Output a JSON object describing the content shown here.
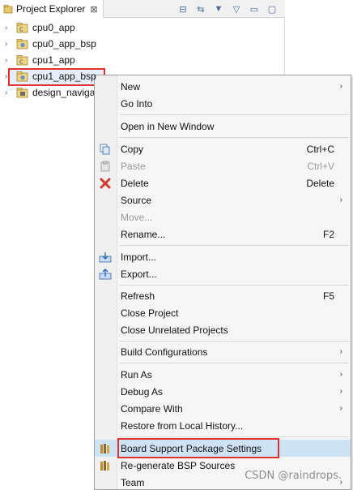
{
  "colors": {
    "selection_outline": "#e0322f",
    "menu_highlight": "#cfe3f7",
    "menu_bg": "#f6f6f6"
  },
  "view": {
    "title": "Project Explorer",
    "close_glyph": "⊠",
    "toolbar": [
      {
        "name": "collapse-all-icon",
        "glyph": "⊟"
      },
      {
        "name": "link-with-editor-icon",
        "glyph": "⇆"
      },
      {
        "name": "filter-icon",
        "glyph": "▼"
      },
      {
        "name": "view-menu-icon",
        "glyph": "▽"
      },
      {
        "name": "minimize-icon",
        "glyph": "▭"
      },
      {
        "name": "maximize-icon",
        "glyph": "▢"
      }
    ]
  },
  "tree": {
    "items": [
      {
        "label": "cpu0_app",
        "icon": "c-project-icon"
      },
      {
        "label": "cpu0_app_bsp",
        "icon": "bsp-project-icon"
      },
      {
        "label": "cpu1_app",
        "icon": "c-project-icon"
      },
      {
        "label": "cpu1_app_bsp",
        "icon": "bsp-project-icon",
        "selected": true
      },
      {
        "label": "design_naviga",
        "icon": "hw-platform-icon"
      }
    ]
  },
  "menu": {
    "items": [
      {
        "label": "New",
        "accel": "",
        "submenu": true,
        "disabled": false,
        "icon": ""
      },
      {
        "label": "Go Into",
        "accel": "",
        "submenu": false,
        "disabled": false,
        "icon": ""
      },
      {
        "sep": true
      },
      {
        "label": "Open in New Window",
        "accel": "",
        "submenu": false,
        "disabled": false,
        "icon": ""
      },
      {
        "sep": true
      },
      {
        "label": "Copy",
        "accel": "Ctrl+C",
        "submenu": false,
        "disabled": false,
        "icon": "copy-icon"
      },
      {
        "label": "Paste",
        "accel": "Ctrl+V",
        "submenu": false,
        "disabled": true,
        "icon": "paste-icon"
      },
      {
        "label": "Delete",
        "accel": "Delete",
        "submenu": false,
        "disabled": false,
        "icon": "delete-icon"
      },
      {
        "label": "Source",
        "accel": "",
        "submenu": true,
        "disabled": false,
        "icon": ""
      },
      {
        "label": "Move...",
        "accel": "",
        "submenu": false,
        "disabled": true,
        "icon": ""
      },
      {
        "label": "Rename...",
        "accel": "F2",
        "submenu": false,
        "disabled": false,
        "icon": ""
      },
      {
        "sep": true
      },
      {
        "label": "Import...",
        "accel": "",
        "submenu": false,
        "disabled": false,
        "icon": "import-icon"
      },
      {
        "label": "Export...",
        "accel": "",
        "submenu": false,
        "disabled": false,
        "icon": "export-icon"
      },
      {
        "sep": true
      },
      {
        "label": "Refresh",
        "accel": "F5",
        "submenu": false,
        "disabled": false,
        "icon": ""
      },
      {
        "label": "Close Project",
        "accel": "",
        "submenu": false,
        "disabled": false,
        "icon": ""
      },
      {
        "label": "Close Unrelated Projects",
        "accel": "",
        "submenu": false,
        "disabled": false,
        "icon": ""
      },
      {
        "sep": true
      },
      {
        "label": "Build Configurations",
        "accel": "",
        "submenu": true,
        "disabled": false,
        "icon": ""
      },
      {
        "sep": true
      },
      {
        "label": "Run As",
        "accel": "",
        "submenu": true,
        "disabled": false,
        "icon": ""
      },
      {
        "label": "Debug As",
        "accel": "",
        "submenu": true,
        "disabled": false,
        "icon": ""
      },
      {
        "label": "Compare With",
        "accel": "",
        "submenu": true,
        "disabled": false,
        "icon": ""
      },
      {
        "label": "Restore from Local History...",
        "accel": "",
        "submenu": false,
        "disabled": false,
        "icon": ""
      },
      {
        "sep": true
      },
      {
        "label": "Board Support Package Settings",
        "accel": "",
        "submenu": false,
        "disabled": false,
        "icon": "bsp-settings-icon",
        "highlight": true
      },
      {
        "label": "Re-generate BSP Sources",
        "accel": "",
        "submenu": false,
        "disabled": false,
        "icon": "bsp-regenerate-icon"
      },
      {
        "label": "Team",
        "accel": "",
        "submenu": true,
        "disabled": false,
        "icon": ""
      }
    ]
  },
  "watermark": "CSDN @raindrops."
}
